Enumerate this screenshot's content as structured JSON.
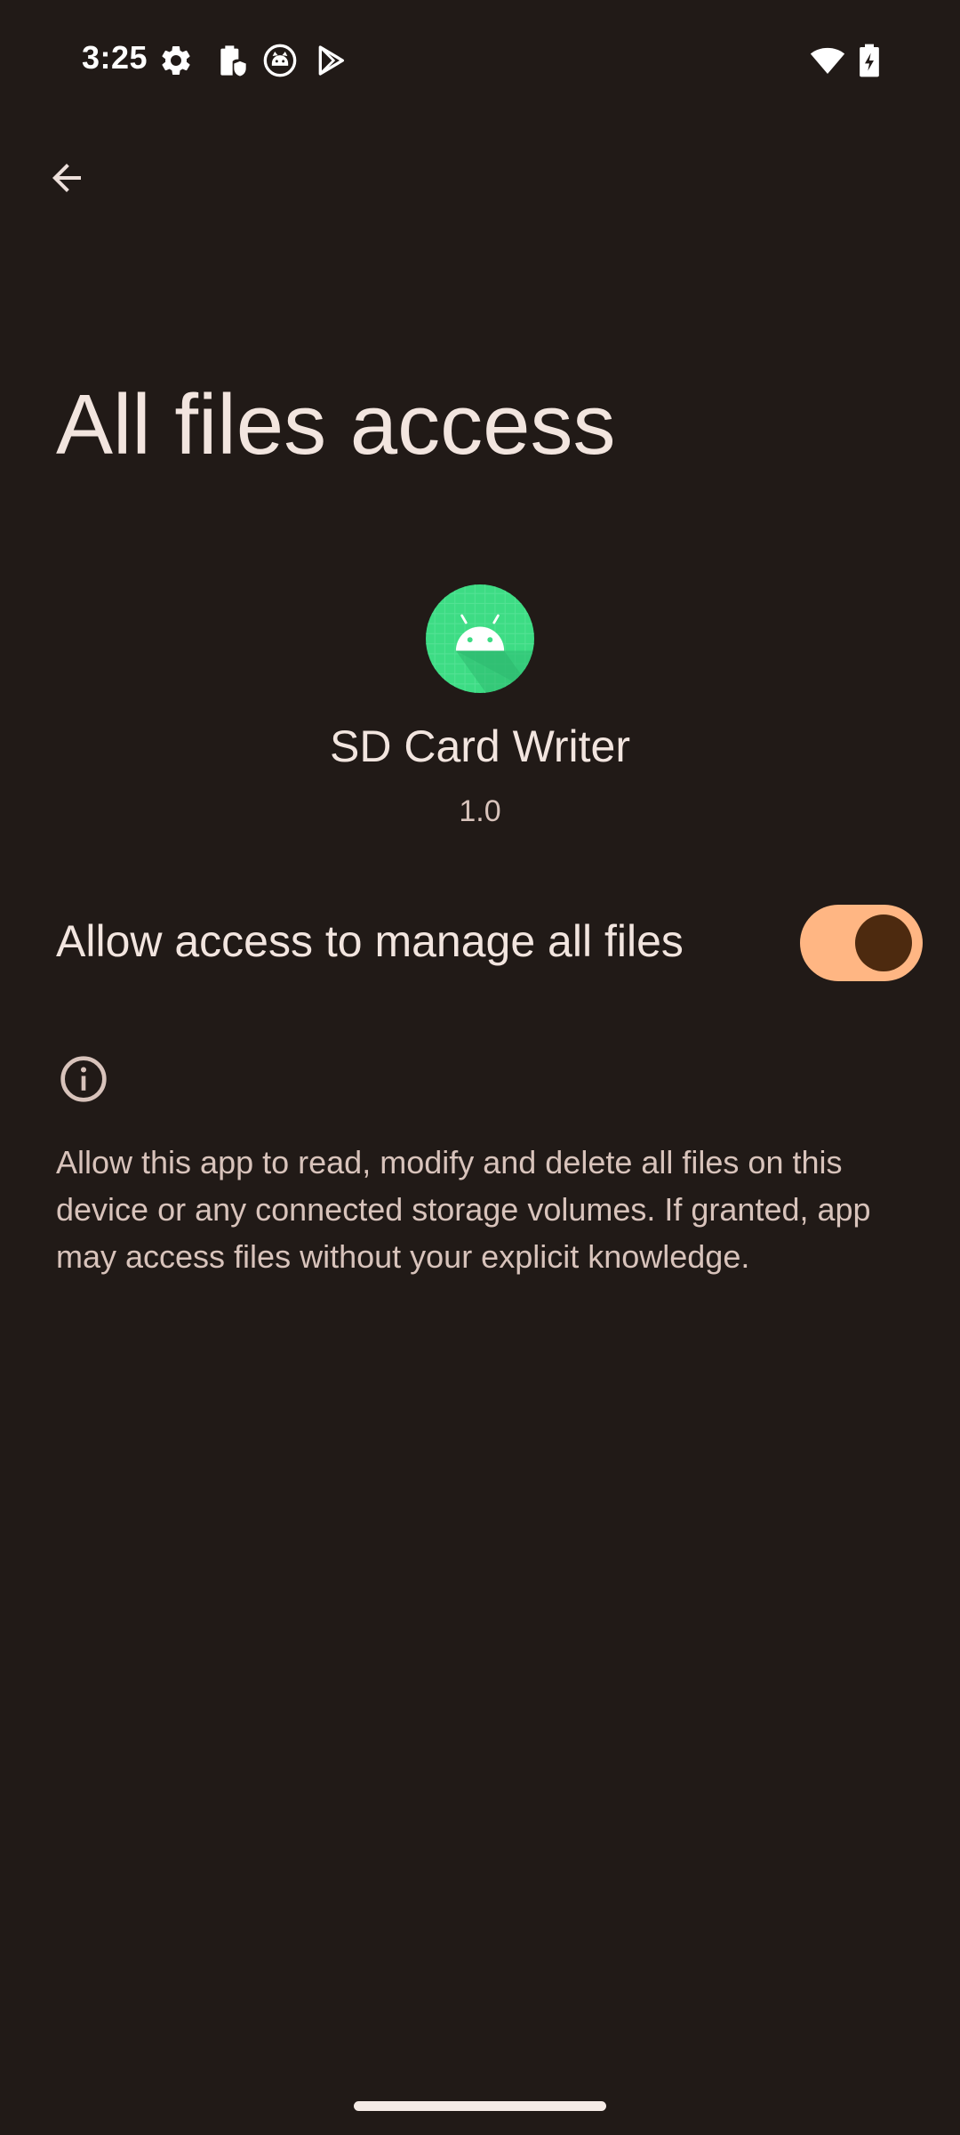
{
  "status_bar": {
    "time": "3:25",
    "icons": [
      "settings-icon",
      "clipboard-shield-icon",
      "cat-face-icon",
      "play-store-icon",
      "wifi-icon",
      "battery-charging-icon"
    ]
  },
  "header": {
    "back_icon": "arrow-back-icon",
    "title": "All files access"
  },
  "app": {
    "icon": "android-app-icon",
    "name": "SD Card Writer",
    "version": "1.0"
  },
  "permission": {
    "label": "Allow access to manage all files",
    "enabled": true
  },
  "info": {
    "icon": "info-icon",
    "text": "Allow this app to read, modify and delete all files on this device or any connected storage volumes. If granted, app may access files without your explicit knowledge."
  },
  "colors": {
    "background": "#211a17",
    "toggle_track": "#ffb683",
    "toggle_thumb": "#4d2a0f",
    "app_icon_green": "#3ddc84"
  }
}
